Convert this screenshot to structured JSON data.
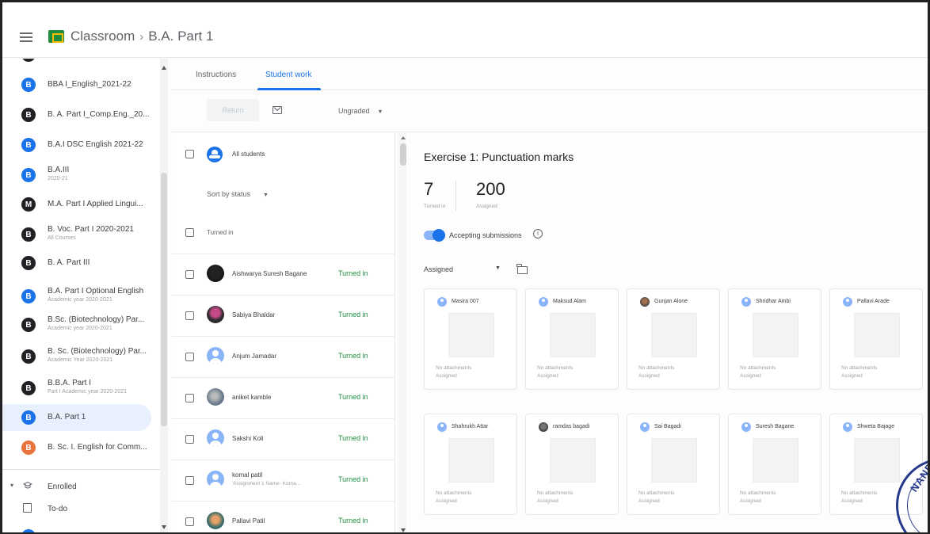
{
  "header": {
    "app_name": "Classroom",
    "separator": "›",
    "class_name": "B.A. Part 1"
  },
  "sidebar": {
    "items": [
      {
        "initial": "B",
        "color": "#1a73e8",
        "title": "BBA I_English_2021-22",
        "sub": ""
      },
      {
        "initial": "B",
        "color": "#202124",
        "title": "B. A. Part I_Comp.Eng._20...",
        "sub": ""
      },
      {
        "initial": "B",
        "color": "#1a73e8",
        "title": "B.A.I DSC English 2021-22",
        "sub": ""
      },
      {
        "initial": "B",
        "color": "#1a73e8",
        "title": "B.A.III",
        "sub": "2020-21"
      },
      {
        "initial": "M",
        "color": "#202124",
        "title": "M.A. Part I Applied Lingui...",
        "sub": ""
      },
      {
        "initial": "B",
        "color": "#202124",
        "title": "B. Voc. Part I 2020-2021",
        "sub": "All Courses"
      },
      {
        "initial": "B",
        "color": "#202124",
        "title": "B. A. Part III",
        "sub": ""
      },
      {
        "initial": "B",
        "color": "#1a73e8",
        "title": "B.A. Part I Optional English",
        "sub": "Academic year 2020-2021"
      },
      {
        "initial": "B",
        "color": "#202124",
        "title": "B.Sc. (Biotechnology) Par...",
        "sub": "Academic year 2020-2021"
      },
      {
        "initial": "B",
        "color": "#202124",
        "title": "B. Sc. (Biotechnology) Par...",
        "sub": "Academic Year 2020-2021"
      },
      {
        "initial": "B",
        "color": "#202124",
        "title": "B.B.A. Part I",
        "sub": "Part I Academic year 2020-2021"
      },
      {
        "initial": "B",
        "color": "#1a73e8",
        "title": "B.A. Part 1",
        "sub": ""
      },
      {
        "initial": "B",
        "color": "#e8743b",
        "title": "B. Sc. I. English for Comm...",
        "sub": ""
      }
    ],
    "enrolled": "Enrolled",
    "todo": "To-do"
  },
  "tabs": {
    "instructions": "Instructions",
    "student_work": "Student work"
  },
  "toolbar": {
    "return_label": "Return",
    "grade_filter": "Ungraded"
  },
  "student_list": {
    "all_students": "All students",
    "sort_label": "Sort by status",
    "group_label": "Turned in",
    "students": [
      {
        "name": "Aishwarya Suresh Bagane",
        "sub": "",
        "status": "Turned in"
      },
      {
        "name": "Sabiya Bhaldar",
        "sub": "",
        "status": "Turned in"
      },
      {
        "name": "Anjum Jamadar",
        "sub": "",
        "status": "Turned in"
      },
      {
        "name": "aniket kamble",
        "sub": "",
        "status": "Turned in"
      },
      {
        "name": "Sakshi Koli",
        "sub": "",
        "status": "Turned in"
      },
      {
        "name": "komal patil",
        "sub": "'Assignment 1 Name- Koma...",
        "status": "Turned in"
      },
      {
        "name": "Pallavi Patil",
        "sub": "",
        "status": "Turned in"
      }
    ]
  },
  "detail": {
    "title": "Exercise 1: Punctuation marks",
    "turned_in_count": "7",
    "turned_in_label": "Turned in",
    "assigned_count": "200",
    "assigned_label": "Assigned",
    "accepting_label": "Accepting submissions",
    "accepting_on": true,
    "filter_label": "Assigned",
    "cards": [
      {
        "name": "Masira 007",
        "attachments": "No attachments",
        "status": "Assigned"
      },
      {
        "name": "Maksud Alam",
        "attachments": "No attachments",
        "status": "Assigned"
      },
      {
        "name": "Gunjan Alone",
        "attachments": "No attachments",
        "status": "Assigned"
      },
      {
        "name": "Shridhar Ambi",
        "attachments": "No attachments",
        "status": "Assigned"
      },
      {
        "name": "Pallavi Arade",
        "attachments": "No attachments",
        "status": "Assigned"
      },
      {
        "name": "Shahrukh Attar",
        "attachments": "No attachments",
        "status": "Assigned"
      },
      {
        "name": "ramdas bagadi",
        "attachments": "No attachments",
        "status": "Assigned"
      },
      {
        "name": "Sai Bagadi",
        "attachments": "No attachments",
        "status": "Assigned"
      },
      {
        "name": "Suresh Bagane",
        "attachments": "No attachments",
        "status": "Assigned"
      },
      {
        "name": "Shweta Bajage",
        "attachments": "No attachments",
        "status": "Assigned"
      }
    ]
  },
  "stamp_text": "NAND",
  "colors": {
    "accent": "#1a73e8",
    "turned_in": "#1e8e3e",
    "classroom_green": "#1e8e3e"
  }
}
